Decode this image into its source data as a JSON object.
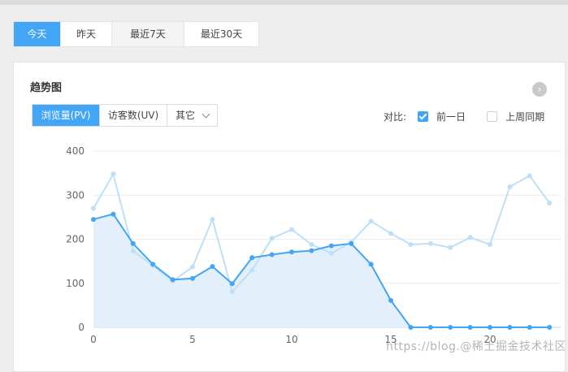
{
  "date_tabs": [
    "今天",
    "昨天",
    "最近7天",
    "最近30天"
  ],
  "active_date_tab": 0,
  "panel": {
    "title": "趋势图",
    "metric_tabs": [
      "浏览量(PV)",
      "访客数(UV)"
    ],
    "metric_dropdown": "其它",
    "compare_label": "对比:",
    "compare_options": [
      {
        "label": "前一日",
        "checked": true
      },
      {
        "label": "上周同期",
        "checked": false
      }
    ]
  },
  "chart_data": {
    "type": "line",
    "x": [
      0,
      1,
      2,
      3,
      4,
      5,
      6,
      7,
      8,
      9,
      10,
      11,
      12,
      13,
      14,
      15,
      16,
      17,
      18,
      19,
      20,
      21,
      22,
      23
    ],
    "x_ticks": [
      0,
      5,
      10,
      15,
      20
    ],
    "ylim": [
      0,
      400
    ],
    "y_ticks": [
      0,
      100,
      200,
      300,
      400
    ],
    "grid": true,
    "series": [
      {
        "values": [
          245,
          257,
          190,
          143,
          108,
          111,
          138,
          99,
          158,
          165,
          171,
          174,
          185,
          190,
          143,
          61,
          0,
          0,
          0,
          0,
          0,
          0,
          0,
          0
        ],
        "color": "#42a5f5",
        "area": true
      },
      {
        "values": [
          270,
          348,
          173,
          140,
          105,
          137,
          245,
          81,
          130,
          202,
          222,
          188,
          168,
          193,
          241,
          213,
          188,
          190,
          181,
          204,
          188,
          319,
          344,
          282
        ],
        "color": "#bde0f8",
        "area": false
      }
    ]
  },
  "colors": {
    "accent": "#42a5f5",
    "accent_light": "#bde0f8",
    "area_fill": "#e3f0fc"
  },
  "watermark": "https://blog.@稀土掘金技术社区"
}
